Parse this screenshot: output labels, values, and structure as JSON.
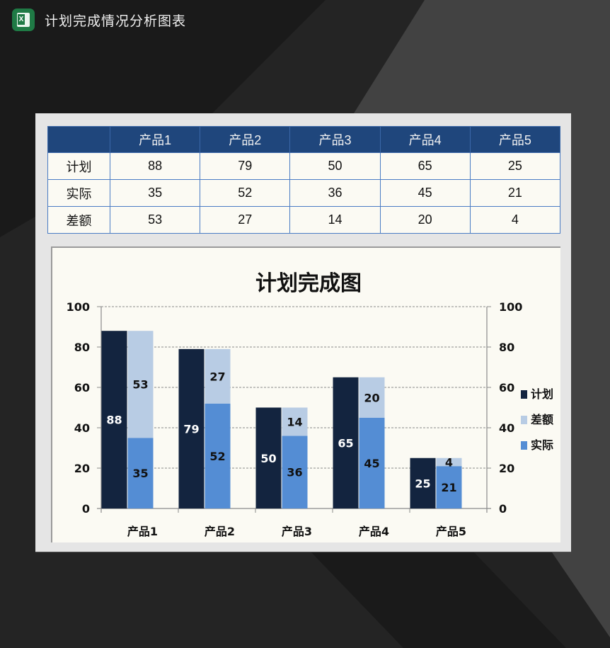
{
  "app": {
    "title": "计划完成情况分析图表",
    "icon": "excel-icon",
    "icon_letter": "X"
  },
  "table": {
    "columns": [
      "",
      "产品1",
      "产品2",
      "产品3",
      "产品4",
      "产品5"
    ],
    "rows": [
      {
        "label": "计划",
        "values": [
          "88",
          "79",
          "50",
          "65",
          "25"
        ]
      },
      {
        "label": "实际",
        "values": [
          "35",
          "52",
          "36",
          "45",
          "21"
        ]
      },
      {
        "label": "差额",
        "values": [
          "53",
          "27",
          "14",
          "20",
          "4"
        ]
      }
    ]
  },
  "colors": {
    "plan": "#13243f",
    "actual": "#548dd4",
    "diff": "#b8cce4",
    "header_bg": "#1f467c",
    "grid_border": "#4a7cc4"
  },
  "chart_data": {
    "type": "bar",
    "title": "计划完成图",
    "categories": [
      "产品1",
      "产品2",
      "产品3",
      "产品4",
      "产品5"
    ],
    "series": [
      {
        "name": "计划",
        "values": [
          88,
          79,
          50,
          65,
          25
        ],
        "stack": "plan",
        "color": "#13243f",
        "label_color": "#ffffff"
      },
      {
        "name": "实际",
        "values": [
          35,
          52,
          36,
          45,
          21
        ],
        "stack": "done",
        "color": "#548dd4",
        "label_color": "#111111"
      },
      {
        "name": "差额",
        "values": [
          53,
          27,
          14,
          20,
          4
        ],
        "stack": "done",
        "color": "#b8cce4",
        "label_color": "#111111"
      }
    ],
    "legend_order": [
      "计划",
      "差额",
      "实际"
    ],
    "legend_position": "right",
    "xlabel": "",
    "ylabel": "",
    "ylim": [
      0,
      100
    ],
    "yticks": [
      0,
      20,
      40,
      60,
      80,
      100
    ],
    "y2ticks": [
      0,
      20,
      40,
      60,
      80,
      100
    ],
    "grid": true,
    "grid_style": "dashed"
  }
}
